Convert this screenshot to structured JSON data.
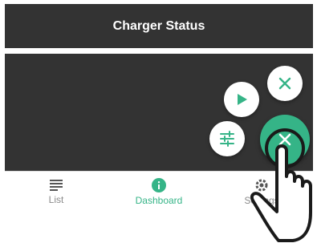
{
  "header": {
    "title": "Charger Status"
  },
  "fab_menu": {
    "close_small_icon": "close-icon",
    "play_icon": "play-icon",
    "filter_icon": "tune-icon",
    "main_icon": "close-icon"
  },
  "bottom_nav": {
    "items": [
      {
        "label": "List",
        "icon": "list-icon"
      },
      {
        "label": "Dashboard",
        "icon": "info-icon"
      },
      {
        "label": "Settings",
        "icon": "gear-icon"
      }
    ],
    "active": "Dashboard"
  },
  "colors": {
    "accent": "#35b487",
    "bar": "#333333",
    "nav_inactive": "#8a8a8a"
  }
}
